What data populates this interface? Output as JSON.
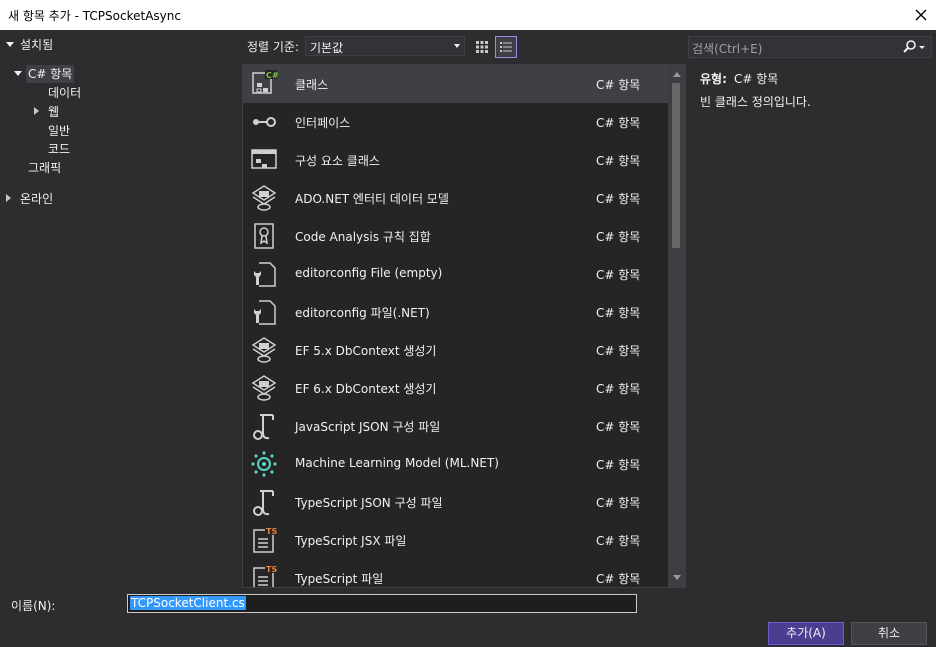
{
  "window": {
    "title": "새 항목 추가 - TCPSocketAsync"
  },
  "tree": {
    "installed": "설치됨",
    "csharp": "C# 항목",
    "data": "데이터",
    "web": "웹",
    "general": "일반",
    "code": "코드",
    "graphics": "그래픽",
    "online": "온라인"
  },
  "toolbar": {
    "sort_label": "정렬 기준:",
    "sort_value": "기본값"
  },
  "search": {
    "placeholder": "검색(Ctrl+E)"
  },
  "templates": [
    {
      "name": "클래스",
      "type": "C# 항목",
      "icon": "class-icon"
    },
    {
      "name": "인터페이스",
      "type": "C# 항목",
      "icon": "interface-icon"
    },
    {
      "name": "구성 요소 클래스",
      "type": "C# 항목",
      "icon": "component-class-icon"
    },
    {
      "name": "ADO.NET 엔터티 데이터 모델",
      "type": "C# 항목",
      "icon": "entity-model-icon"
    },
    {
      "name": "Code Analysis 규칙 집합",
      "type": "C# 항목",
      "icon": "ruleset-icon"
    },
    {
      "name": "editorconfig File (empty)",
      "type": "C# 항목",
      "icon": "editorconfig-icon"
    },
    {
      "name": "editorconfig 파일(.NET)",
      "type": "C# 항목",
      "icon": "editorconfig-icon"
    },
    {
      "name": "EF 5.x DbContext 생성기",
      "type": "C# 항목",
      "icon": "dbcontext-icon"
    },
    {
      "name": "EF 6.x DbContext 생성기",
      "type": "C# 항목",
      "icon": "dbcontext-icon"
    },
    {
      "name": "JavaScript JSON 구성 파일",
      "type": "C# 항목",
      "icon": "json-config-icon"
    },
    {
      "name": "Machine Learning Model (ML.NET)",
      "type": "C# 항목",
      "icon": "ml-model-icon"
    },
    {
      "name": "TypeScript JSON 구성 파일",
      "type": "C# 항목",
      "icon": "json-config-icon"
    },
    {
      "name": "TypeScript JSX 파일",
      "type": "C# 항목",
      "icon": "typescript-file-icon"
    },
    {
      "name": "TypeScript 파일",
      "type": "C# 항목",
      "icon": "typescript-file-icon"
    }
  ],
  "details": {
    "type_label": "유형:",
    "type_value": "C# 항목",
    "description": "빈 클래스 정의입니다."
  },
  "bottom": {
    "name_label": "이름(N):",
    "name_value": "TCPSocketClient.cs",
    "add_label": "추가(A)",
    "cancel_label": "취소"
  },
  "colors": {
    "accent": "#9d8ce3",
    "primary_button": "#4b3d8f",
    "selection": "#3f3f46",
    "text_selection": "#3399ff"
  }
}
